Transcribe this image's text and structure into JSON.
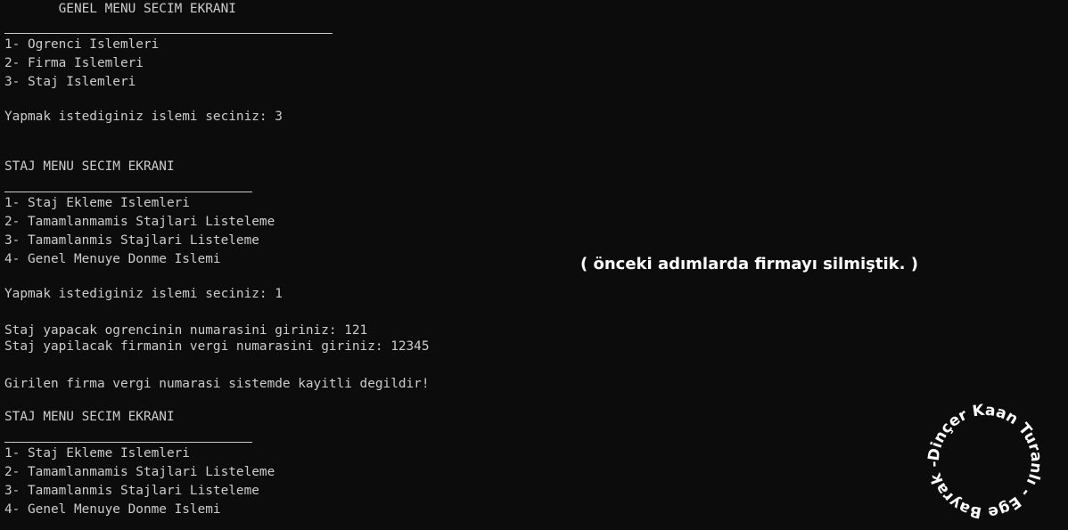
{
  "console": {
    "lines": [
      "       GENEL MENU SECIM EKRANI",
      "1- Ogrenci Islemleri",
      "2- Firma Islemleri",
      "3- Staj Islemleri",
      "Yapmak istediginiz islemi seciniz: 3",
      "STAJ MENU SECIM EKRANI",
      "1- Staj Ekleme Islemleri",
      "2- Tamamlanmamis Stajlari Listeleme",
      "3- Tamamlanmis Stajlari Listeleme",
      "4- Genel Menuye Donme Islemi",
      "Yapmak istediginiz islemi seciniz: 1",
      "Staj yapacak ogrencinin numarasini giriniz: 121",
      "Staj yapilacak firmanin vergi numarasini giriniz: 12345",
      "Girilen firma vergi numarasi sistemde kayitli degildir!",
      "STAJ MENU SECIM EKRANI",
      "1- Staj Ekleme Islemleri",
      "2- Tamamlanmamis Stajlari Listeleme",
      "3- Tamamlanmis Stajlari Listeleme",
      "4- Genel Menuye Donme Islemi"
    ]
  },
  "annotation": "( önceki adımlarda firmayı silmiştik. )",
  "seal": {
    "text": "Dinçer Kaan Turanlı - Ege Bayrak - "
  },
  "colors": {
    "background": "#0c0c0c",
    "text": "#cccccc",
    "annotation": "#ffffff"
  }
}
